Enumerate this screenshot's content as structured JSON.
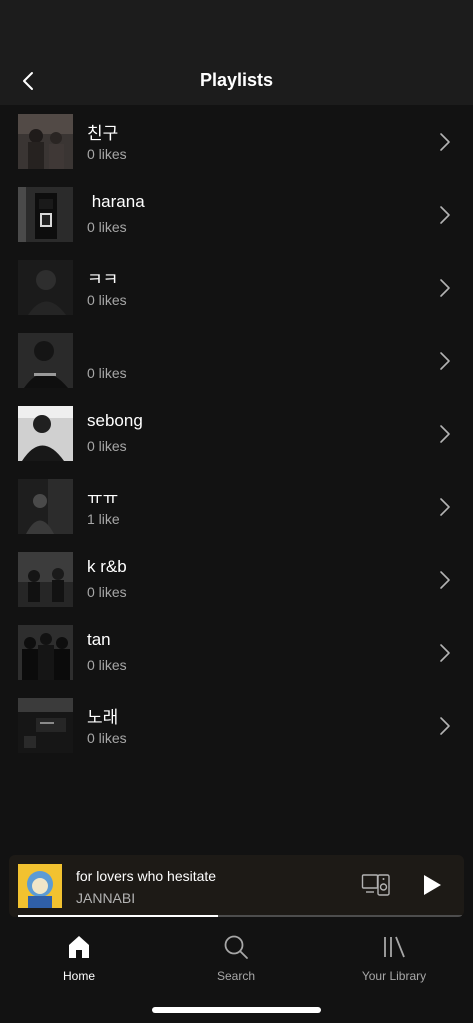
{
  "header": {
    "title": "Playlists",
    "back_icon": "chevron-left-icon"
  },
  "playlists": [
    {
      "title": "친구",
      "likes": "0 likes"
    },
    {
      "title": " harana",
      "likes": "0 likes"
    },
    {
      "title": "ㅋㅋ",
      "likes": "0 likes"
    },
    {
      "title": "",
      "likes": "0 likes"
    },
    {
      "title": "sebong",
      "likes": "0 likes"
    },
    {
      "title": "ㅠㅠ",
      "likes": "1 like"
    },
    {
      "title": "k r&b",
      "likes": "0 likes"
    },
    {
      "title": "tan",
      "likes": "0 likes"
    },
    {
      "title": "노래",
      "likes": "0 likes"
    }
  ],
  "player": {
    "track": "for lovers who hesitate",
    "artist": "JANNABI",
    "progress": 0.45,
    "devices_icon": "devices-icon",
    "play_icon": "play-icon"
  },
  "nav": {
    "items": [
      {
        "label": "Home",
        "icon": "home-icon",
        "active": true
      },
      {
        "label": "Search",
        "icon": "search-icon",
        "active": false
      },
      {
        "label": "Your Library",
        "icon": "library-icon",
        "active": false
      }
    ]
  },
  "colors": {
    "background": "#121212",
    "header": "#1c1c1c",
    "player": "#1d1a16",
    "text_secondary": "#a7a7a7"
  }
}
